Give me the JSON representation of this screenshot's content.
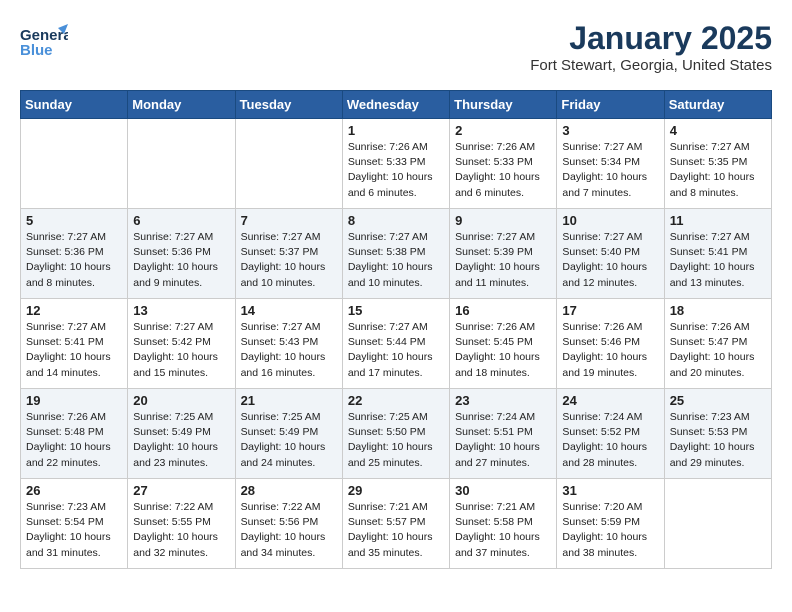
{
  "header": {
    "logo_line1": "General",
    "logo_line2": "Blue",
    "month_title": "January 2025",
    "location": "Fort Stewart, Georgia, United States"
  },
  "days_of_week": [
    "Sunday",
    "Monday",
    "Tuesday",
    "Wednesday",
    "Thursday",
    "Friday",
    "Saturday"
  ],
  "weeks": [
    [
      {
        "num": "",
        "detail": ""
      },
      {
        "num": "",
        "detail": ""
      },
      {
        "num": "",
        "detail": ""
      },
      {
        "num": "1",
        "detail": "Sunrise: 7:26 AM\nSunset: 5:33 PM\nDaylight: 10 hours\nand 6 minutes."
      },
      {
        "num": "2",
        "detail": "Sunrise: 7:26 AM\nSunset: 5:33 PM\nDaylight: 10 hours\nand 6 minutes."
      },
      {
        "num": "3",
        "detail": "Sunrise: 7:27 AM\nSunset: 5:34 PM\nDaylight: 10 hours\nand 7 minutes."
      },
      {
        "num": "4",
        "detail": "Sunrise: 7:27 AM\nSunset: 5:35 PM\nDaylight: 10 hours\nand 8 minutes."
      }
    ],
    [
      {
        "num": "5",
        "detail": "Sunrise: 7:27 AM\nSunset: 5:36 PM\nDaylight: 10 hours\nand 8 minutes."
      },
      {
        "num": "6",
        "detail": "Sunrise: 7:27 AM\nSunset: 5:36 PM\nDaylight: 10 hours\nand 9 minutes."
      },
      {
        "num": "7",
        "detail": "Sunrise: 7:27 AM\nSunset: 5:37 PM\nDaylight: 10 hours\nand 10 minutes."
      },
      {
        "num": "8",
        "detail": "Sunrise: 7:27 AM\nSunset: 5:38 PM\nDaylight: 10 hours\nand 10 minutes."
      },
      {
        "num": "9",
        "detail": "Sunrise: 7:27 AM\nSunset: 5:39 PM\nDaylight: 10 hours\nand 11 minutes."
      },
      {
        "num": "10",
        "detail": "Sunrise: 7:27 AM\nSunset: 5:40 PM\nDaylight: 10 hours\nand 12 minutes."
      },
      {
        "num": "11",
        "detail": "Sunrise: 7:27 AM\nSunset: 5:41 PM\nDaylight: 10 hours\nand 13 minutes."
      }
    ],
    [
      {
        "num": "12",
        "detail": "Sunrise: 7:27 AM\nSunset: 5:41 PM\nDaylight: 10 hours\nand 14 minutes."
      },
      {
        "num": "13",
        "detail": "Sunrise: 7:27 AM\nSunset: 5:42 PM\nDaylight: 10 hours\nand 15 minutes."
      },
      {
        "num": "14",
        "detail": "Sunrise: 7:27 AM\nSunset: 5:43 PM\nDaylight: 10 hours\nand 16 minutes."
      },
      {
        "num": "15",
        "detail": "Sunrise: 7:27 AM\nSunset: 5:44 PM\nDaylight: 10 hours\nand 17 minutes."
      },
      {
        "num": "16",
        "detail": "Sunrise: 7:26 AM\nSunset: 5:45 PM\nDaylight: 10 hours\nand 18 minutes."
      },
      {
        "num": "17",
        "detail": "Sunrise: 7:26 AM\nSunset: 5:46 PM\nDaylight: 10 hours\nand 19 minutes."
      },
      {
        "num": "18",
        "detail": "Sunrise: 7:26 AM\nSunset: 5:47 PM\nDaylight: 10 hours\nand 20 minutes."
      }
    ],
    [
      {
        "num": "19",
        "detail": "Sunrise: 7:26 AM\nSunset: 5:48 PM\nDaylight: 10 hours\nand 22 minutes."
      },
      {
        "num": "20",
        "detail": "Sunrise: 7:25 AM\nSunset: 5:49 PM\nDaylight: 10 hours\nand 23 minutes."
      },
      {
        "num": "21",
        "detail": "Sunrise: 7:25 AM\nSunset: 5:49 PM\nDaylight: 10 hours\nand 24 minutes."
      },
      {
        "num": "22",
        "detail": "Sunrise: 7:25 AM\nSunset: 5:50 PM\nDaylight: 10 hours\nand 25 minutes."
      },
      {
        "num": "23",
        "detail": "Sunrise: 7:24 AM\nSunset: 5:51 PM\nDaylight: 10 hours\nand 27 minutes."
      },
      {
        "num": "24",
        "detail": "Sunrise: 7:24 AM\nSunset: 5:52 PM\nDaylight: 10 hours\nand 28 minutes."
      },
      {
        "num": "25",
        "detail": "Sunrise: 7:23 AM\nSunset: 5:53 PM\nDaylight: 10 hours\nand 29 minutes."
      }
    ],
    [
      {
        "num": "26",
        "detail": "Sunrise: 7:23 AM\nSunset: 5:54 PM\nDaylight: 10 hours\nand 31 minutes."
      },
      {
        "num": "27",
        "detail": "Sunrise: 7:22 AM\nSunset: 5:55 PM\nDaylight: 10 hours\nand 32 minutes."
      },
      {
        "num": "28",
        "detail": "Sunrise: 7:22 AM\nSunset: 5:56 PM\nDaylight: 10 hours\nand 34 minutes."
      },
      {
        "num": "29",
        "detail": "Sunrise: 7:21 AM\nSunset: 5:57 PM\nDaylight: 10 hours\nand 35 minutes."
      },
      {
        "num": "30",
        "detail": "Sunrise: 7:21 AM\nSunset: 5:58 PM\nDaylight: 10 hours\nand 37 minutes."
      },
      {
        "num": "31",
        "detail": "Sunrise: 7:20 AM\nSunset: 5:59 PM\nDaylight: 10 hours\nand 38 minutes."
      },
      {
        "num": "",
        "detail": ""
      }
    ]
  ]
}
